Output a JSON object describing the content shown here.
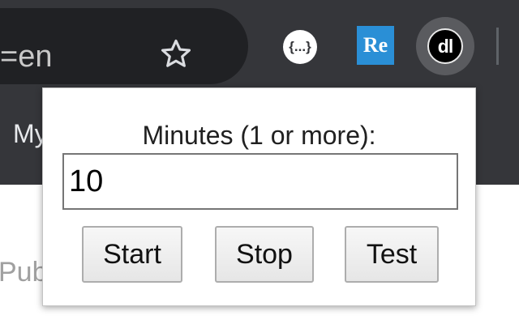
{
  "browser": {
    "address_bar": {
      "visible_text": "=en"
    },
    "bookmark_star": {
      "icon": "star-outline-icon"
    },
    "extensions": [
      {
        "name": "braces-extension",
        "label": "{...}"
      },
      {
        "name": "re-extension",
        "label": "Re",
        "color": "#2a8fd6"
      },
      {
        "name": "dl-extension",
        "label": "dl",
        "active": true
      }
    ],
    "bookmarks_bar": {
      "visible_item_text": "My"
    }
  },
  "page": {
    "visible_fragment": "Pub"
  },
  "popup": {
    "label": "Minutes (1 or more):",
    "minutes_input": {
      "value": "10"
    },
    "buttons": {
      "start_label": "Start",
      "stop_label": "Stop",
      "test_label": "Test"
    }
  },
  "colors": {
    "chrome_bg": "#35363a",
    "omnibox_bg": "#202124",
    "popup_bg": "#ffffff"
  }
}
